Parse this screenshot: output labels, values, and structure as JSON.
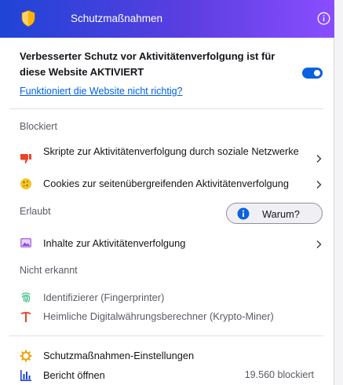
{
  "header": {
    "title": "Schutzmaßnahmen",
    "shield_icon": "shield-icon",
    "info_icon": "info-icon",
    "gradient_start": "#1f44d6",
    "gradient_end": "#8a4dff"
  },
  "etp": {
    "status_text": "Verbesserter Schutz vor Aktivitätenverfolgung ist für diese Website AKTIVIERT",
    "toggle_on": true,
    "broken_link": "Funktioniert die Website nicht richtig?"
  },
  "blocked": {
    "label": "Blockiert",
    "items": [
      {
        "label": "Skripte zur Aktivitätenverfolgung durch soziale Netzwerke",
        "icon": "thumbs-down-icon"
      },
      {
        "label": "Cookies zur seitenübergreifenden Aktivitätenverfolgung",
        "icon": "cookie-icon"
      }
    ]
  },
  "allowed": {
    "label": "Erlaubt",
    "why_button": "Warum?",
    "items": [
      {
        "label": "Inhalte zur Aktivitätenverfolgung",
        "icon": "image-icon"
      }
    ]
  },
  "not_detected": {
    "label": "Nicht erkannt",
    "items": [
      {
        "label": "Identifizierer (Fingerprinter)",
        "icon": "fingerprint-icon"
      },
      {
        "label": "Heimliche Digitalwährungsberechner (Krypto-Miner)",
        "icon": "pickaxe-icon"
      }
    ]
  },
  "footer": {
    "settings_label": "Schutzmaßnahmen-Einstellungen",
    "report_label": "Bericht öffnen",
    "blocked_count": "19.560 blockiert"
  }
}
